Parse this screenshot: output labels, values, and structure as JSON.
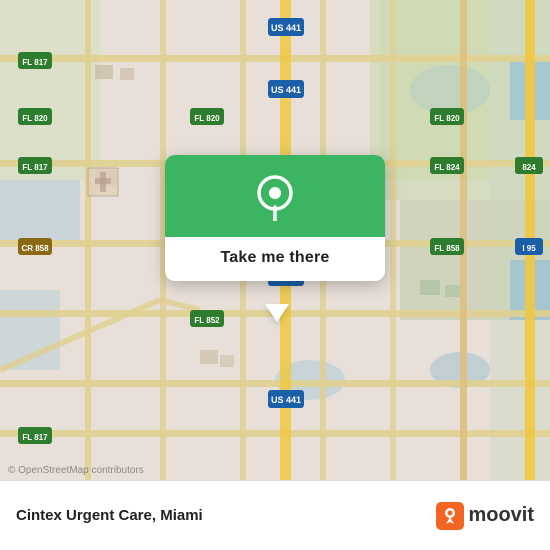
{
  "map": {
    "alt": "Street map of Miami area near Cintex Urgent Care"
  },
  "popup": {
    "button_label": "Take me there"
  },
  "bottom_bar": {
    "place_name": "Cintex Urgent Care,",
    "city": "Miami",
    "osm_credit": "© OpenStreetMap contributors"
  },
  "moovit": {
    "text": "moovit"
  },
  "colors": {
    "green": "#3cb563",
    "map_bg": "#e8e0d8"
  }
}
